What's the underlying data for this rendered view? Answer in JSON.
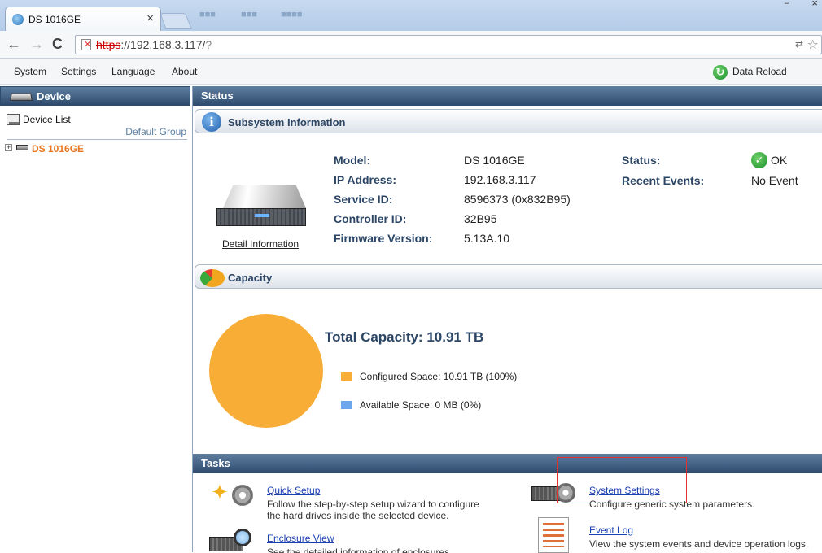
{
  "browser": {
    "tab_title": "DS 1016GE",
    "tab_close": "×",
    "blurred_tabs": [
      "■■■",
      "■■■",
      "■■■■"
    ],
    "url_scheme": "https",
    "url_host": "://192.168.3.117/",
    "url_rest": "?",
    "back": "←",
    "forward": "→",
    "reload": "C",
    "minimize": "–",
    "close": "×",
    "translate_icon": "⇄",
    "star_icon": "☆"
  },
  "menu": {
    "items": [
      "System",
      "Settings",
      "Language",
      "About"
    ],
    "data_reload": "Data Reload"
  },
  "left": {
    "header": "Device",
    "device_list": "Device List",
    "default_group": "Default Group",
    "tree_device": "DS 1016GE",
    "expand": "+"
  },
  "status": {
    "header": "Status",
    "subsystem_title": "Subsystem Information",
    "detail_link": "Detail Information",
    "fields": [
      {
        "label": "Model:",
        "value": "DS 1016GE"
      },
      {
        "label": "IP Address:",
        "value": "192.168.3.117"
      },
      {
        "label": "Service ID:",
        "value": "8596373 (0x832B95)"
      },
      {
        "label": "Controller ID:",
        "value": "32B95"
      },
      {
        "label": "Firmware Version:",
        "value": "5.13A.10"
      }
    ],
    "status_label": "Status:",
    "status_value": "OK",
    "recent_label": "Recent Events:",
    "recent_value": "No Event",
    "info_icon": "i",
    "ok_icon": "✓"
  },
  "capacity": {
    "title": "Capacity",
    "total": "Total Capacity: 10.91 TB",
    "configured": "Configured Space: 10.91 TB (100%)",
    "available": "Available Space: 0 MB (0%)",
    "configured_color": "#f8ad37",
    "available_color": "#6ea6ee",
    "configured_fraction": 1.0
  },
  "tasks": {
    "header": "Tasks",
    "items": [
      {
        "title": "Quick Setup",
        "desc": "Follow the step-by-step setup wizard to configure the hard drives inside the selected device."
      },
      {
        "title": "Enclosure View",
        "desc": "See the detailed information of enclosures"
      },
      {
        "title": "System Settings",
        "desc": "Configure generic system parameters."
      },
      {
        "title": "Event Log",
        "desc": "View the system events and device operation logs."
      }
    ]
  }
}
